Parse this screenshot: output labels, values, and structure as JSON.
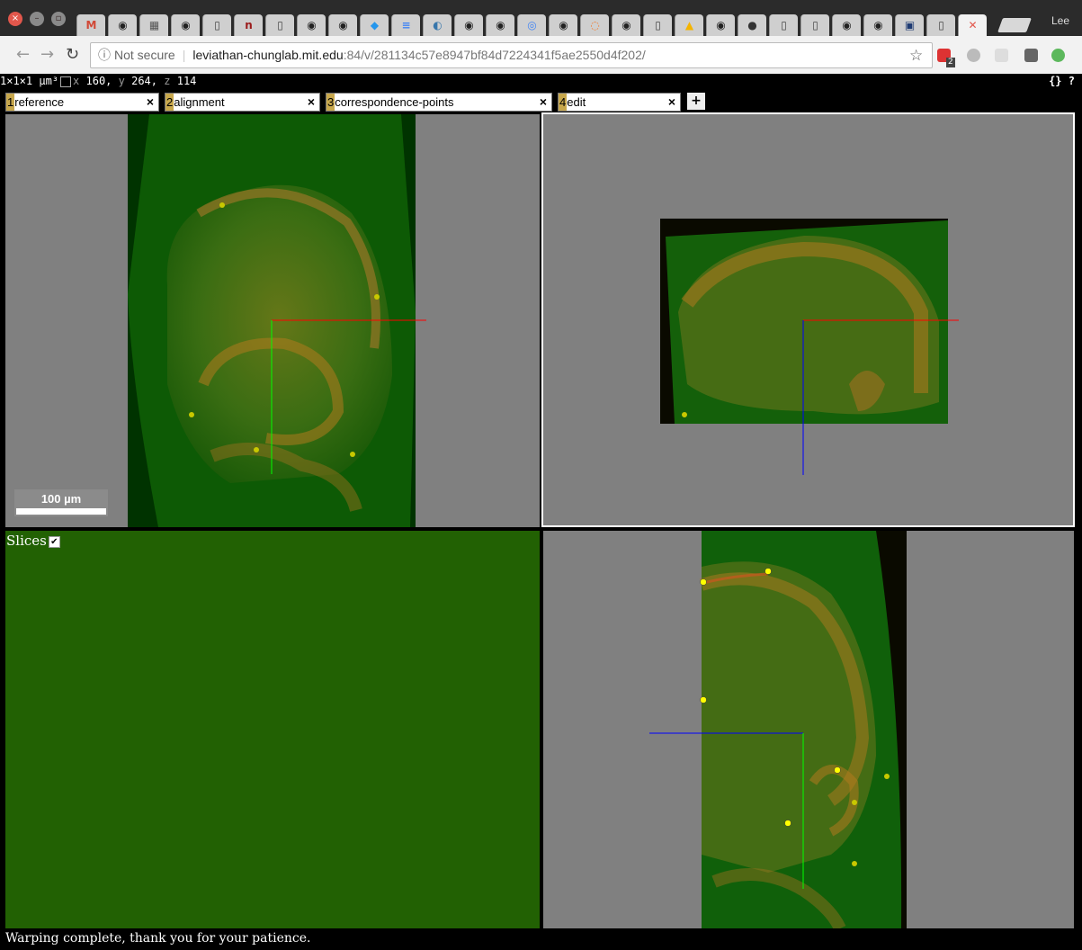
{
  "browser": {
    "window_buttons": [
      "close",
      "minimize",
      "maximize"
    ],
    "tabs": [
      {
        "icon": "gmail-icon",
        "glyph": "M",
        "color": "#d14836"
      },
      {
        "icon": "github-icon",
        "glyph": "◉",
        "color": "#222"
      },
      {
        "icon": "image-icon",
        "glyph": "▦",
        "color": "#555"
      },
      {
        "icon": "github-icon",
        "glyph": "◉",
        "color": "#222"
      },
      {
        "icon": "page-icon",
        "glyph": "▯",
        "color": "#444"
      },
      {
        "icon": "n-icon",
        "glyph": "n",
        "color": "#9b1b1b"
      },
      {
        "icon": "page-icon",
        "glyph": "▯",
        "color": "#444"
      },
      {
        "icon": "github-icon",
        "glyph": "◉",
        "color": "#222"
      },
      {
        "icon": "github-icon",
        "glyph": "◉",
        "color": "#222"
      },
      {
        "icon": "docker-icon",
        "glyph": "◆",
        "color": "#2496ed"
      },
      {
        "icon": "docs-icon",
        "glyph": "≡",
        "color": "#4285f4"
      },
      {
        "icon": "python-icon",
        "glyph": "◐",
        "color": "#3776ab"
      },
      {
        "icon": "github-icon",
        "glyph": "◉",
        "color": "#222"
      },
      {
        "icon": "github-icon",
        "glyph": "◉",
        "color": "#222"
      },
      {
        "icon": "chrome-icon",
        "glyph": "◎",
        "color": "#4285f4"
      },
      {
        "icon": "github-icon",
        "glyph": "◉",
        "color": "#222"
      },
      {
        "icon": "jupyter-icon",
        "glyph": "◌",
        "color": "#f37626"
      },
      {
        "icon": "github-icon",
        "glyph": "◉",
        "color": "#222"
      },
      {
        "icon": "page-icon",
        "glyph": "▯",
        "color": "#444"
      },
      {
        "icon": "drive-icon",
        "glyph": "▲",
        "color": "#f4b400"
      },
      {
        "icon": "github-icon",
        "glyph": "◉",
        "color": "#222"
      },
      {
        "icon": "car-icon",
        "glyph": "●",
        "color": "#333"
      },
      {
        "icon": "page-icon",
        "glyph": "▯",
        "color": "#444"
      },
      {
        "icon": "page-icon",
        "glyph": "▯",
        "color": "#444"
      },
      {
        "icon": "github-icon",
        "glyph": "◉",
        "color": "#222"
      },
      {
        "icon": "github-icon",
        "glyph": "◉",
        "color": "#222"
      },
      {
        "icon": "allen-icon",
        "glyph": "▣",
        "color": "#1f3b73"
      },
      {
        "icon": "page-icon",
        "glyph": "▯",
        "color": "#444"
      },
      {
        "icon": "close-tab-icon",
        "glyph": "✕",
        "color": "#e2574c",
        "active": true
      }
    ],
    "user": "Lee",
    "omnibox": {
      "security": "Not secure",
      "host": "leviathan-chunglab.mit.edu",
      "path": ":84/v/281134c57e8947bf84d7224341f5ae2550d4f202/"
    },
    "extension_badge": "2"
  },
  "viewer": {
    "voxel_size": "1×1×1 µm³",
    "coords": {
      "x_label": "x",
      "x": "160,",
      "y_label": "y",
      "y": "264,",
      "z_label": "z",
      "z": "114"
    },
    "json_button": "{}",
    "help_button": "?",
    "layers": [
      {
        "num": "1",
        "name": "reference"
      },
      {
        "num": "2",
        "name": "alignment"
      },
      {
        "num": "3",
        "name": "correspondence-points"
      },
      {
        "num": "4",
        "name": "edit"
      }
    ],
    "add_layer": "+",
    "close_glyph": "×",
    "scale_bar": "100 µm",
    "slices_label": "Slices",
    "status": "Warping complete, thank you for your patience."
  },
  "colors": {
    "tissue_green": "#1f6a0a",
    "tissue_orange": "#b07a1e",
    "point_yellow": "#e6e600",
    "axis_red": "#ff0000",
    "axis_green": "#00ff00",
    "axis_blue": "#0000ff",
    "panel_bg": "#808080",
    "3d_bg": "#226103"
  }
}
